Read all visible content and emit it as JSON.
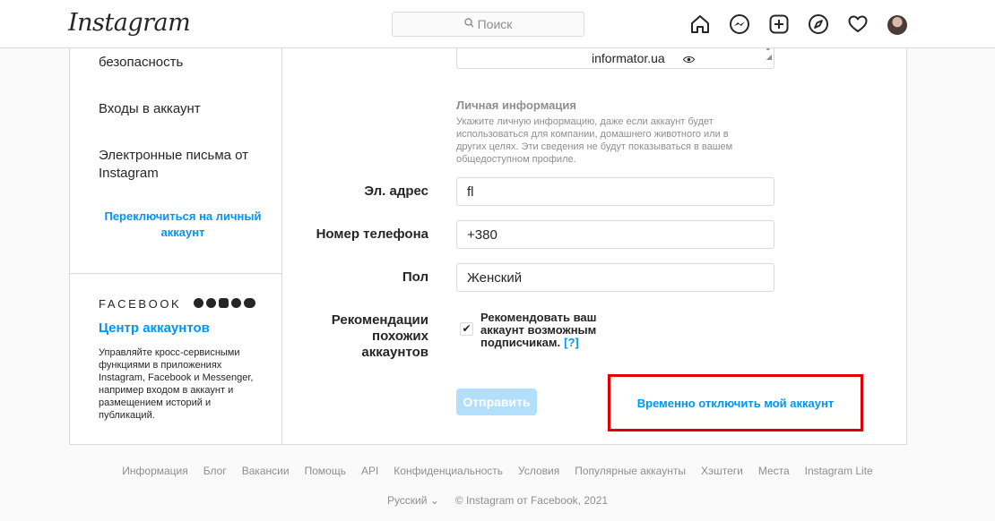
{
  "header": {
    "logo": "Instagram",
    "search_placeholder": "Поиск",
    "icons": [
      "home-icon",
      "messenger-icon",
      "new-post-icon",
      "explore-icon",
      "activity-heart-icon",
      "profile-avatar"
    ]
  },
  "sidebar": {
    "items": [
      {
        "label": "безопасность"
      },
      {
        "label": "Входы в аккаунт"
      },
      {
        "label": "Электронные письма от Instagram"
      }
    ],
    "switch_link": "Переключиться на личный аккаунт",
    "facebook_word": "FACEBOOK",
    "accounts_center": "Центр аккаунтов",
    "accounts_center_desc": "Управляйте кросс-сервисными функциями в приложениях Instagram, Facebook и Messenger, например входом в аккаунт и размещением историй и публикаций."
  },
  "form": {
    "bio_value": "informator.ua",
    "personal_info_title": "Личная информация",
    "personal_info_desc": "Укажите личную информацию, даже если аккаунт будет использоваться для компании, домашнего животного или в других целях. Эти сведения не будут показываться в вашем общедоступном профиле.",
    "email_label": "Эл. адрес",
    "email_value": "fl",
    "phone_label": "Номер телефона",
    "phone_value": "+380",
    "gender_label": "Пол",
    "gender_value": "Женский",
    "recommend_label": "Рекомендации похожих аккаунтов",
    "recommend_text": "Рекомендовать ваш аккаунт возможным подписчикам.",
    "recommend_help": "[?]",
    "recommend_checked": true,
    "submit_label": "Отправить",
    "disable_link": "Временно отключить мой аккаунт"
  },
  "footer": {
    "links": [
      "Информация",
      "Блог",
      "Вакансии",
      "Помощь",
      "API",
      "Конфиденциальность",
      "Условия",
      "Популярные аккаунты",
      "Хэштеги",
      "Места",
      "Instagram Lite"
    ],
    "language": "Русский",
    "copyright": "© Instagram от Facebook, 2021"
  },
  "colors": {
    "accent": "#0095f6",
    "disabled_button": "#b2dffc",
    "highlight_box": "#e00000",
    "border": "#dbdbdb"
  }
}
